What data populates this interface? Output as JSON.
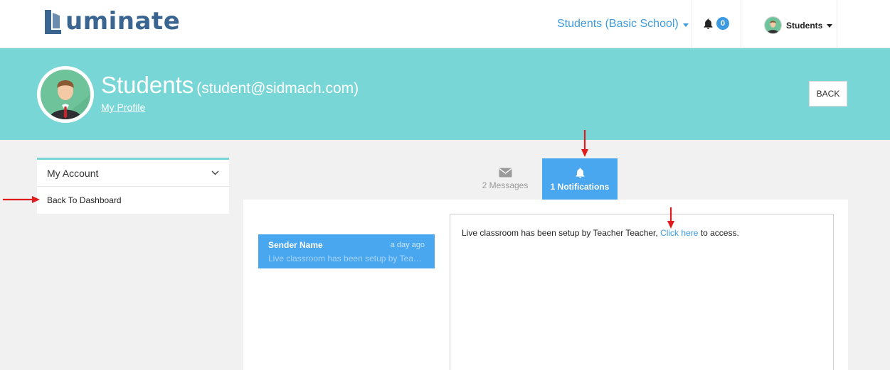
{
  "header": {
    "logo_text": "uminate",
    "school_selector": "Students (Basic School)",
    "notification_count": "0",
    "user_menu_label": "Students"
  },
  "profile": {
    "name": "Students",
    "email": "(student@sidmach.com)",
    "my_profile_link": "My Profile",
    "back_button": "BACK"
  },
  "sidebar": {
    "section_label": "My Account",
    "items": [
      {
        "label": "Back To Dashboard"
      }
    ]
  },
  "tabs": [
    {
      "label": "2 Messages",
      "icon": "envelope-icon",
      "active": false
    },
    {
      "label": "1 Notifications",
      "icon": "bell-icon",
      "active": true
    }
  ],
  "notifications": [
    {
      "sender": "Sender Name",
      "time": "a day ago",
      "preview": "Live classroom has been setup by Teacher Teacher, Click here to access."
    }
  ],
  "detail": {
    "text_before": "Live classroom has been setup by Teacher Teacher, ",
    "link_text": "Click here",
    "text_after": " to access."
  },
  "colors": {
    "banner": "#78d6d6",
    "accent": "#48a7ee",
    "link": "#3c9be0",
    "logo": "#3a6590",
    "annotation_arrow": "#e11b1b"
  }
}
